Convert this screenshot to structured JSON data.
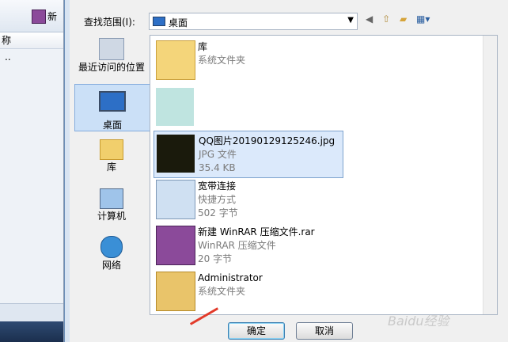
{
  "background_window": {
    "header_col": "称",
    "up_item": ".."
  },
  "dialog": {
    "look_in_label": "查找范围(I):",
    "look_in_value": "桌面",
    "places": [
      {
        "label": "最近访问的位置"
      },
      {
        "label": "桌面"
      },
      {
        "label": "库"
      },
      {
        "label": "计算机"
      },
      {
        "label": "网络"
      }
    ],
    "files": [
      {
        "name": "库",
        "type": "系统文件夹",
        "size": ""
      },
      {
        "name": "QQ图片20190129125246.jpg",
        "type": "JPG 文件",
        "size": "35.4 KB"
      },
      {
        "name": "宽带连接",
        "type": "快捷方式",
        "size": "502 字节"
      },
      {
        "name": "新建 WinRAR 压缩文件.rar",
        "type": "WinRAR 压缩文件",
        "size": "20 字节"
      },
      {
        "name": "Administrator",
        "type": "系统文件夹",
        "size": ""
      }
    ],
    "ok_label": "确定",
    "cancel_label": "取消"
  },
  "watermark": "Baidu经验"
}
